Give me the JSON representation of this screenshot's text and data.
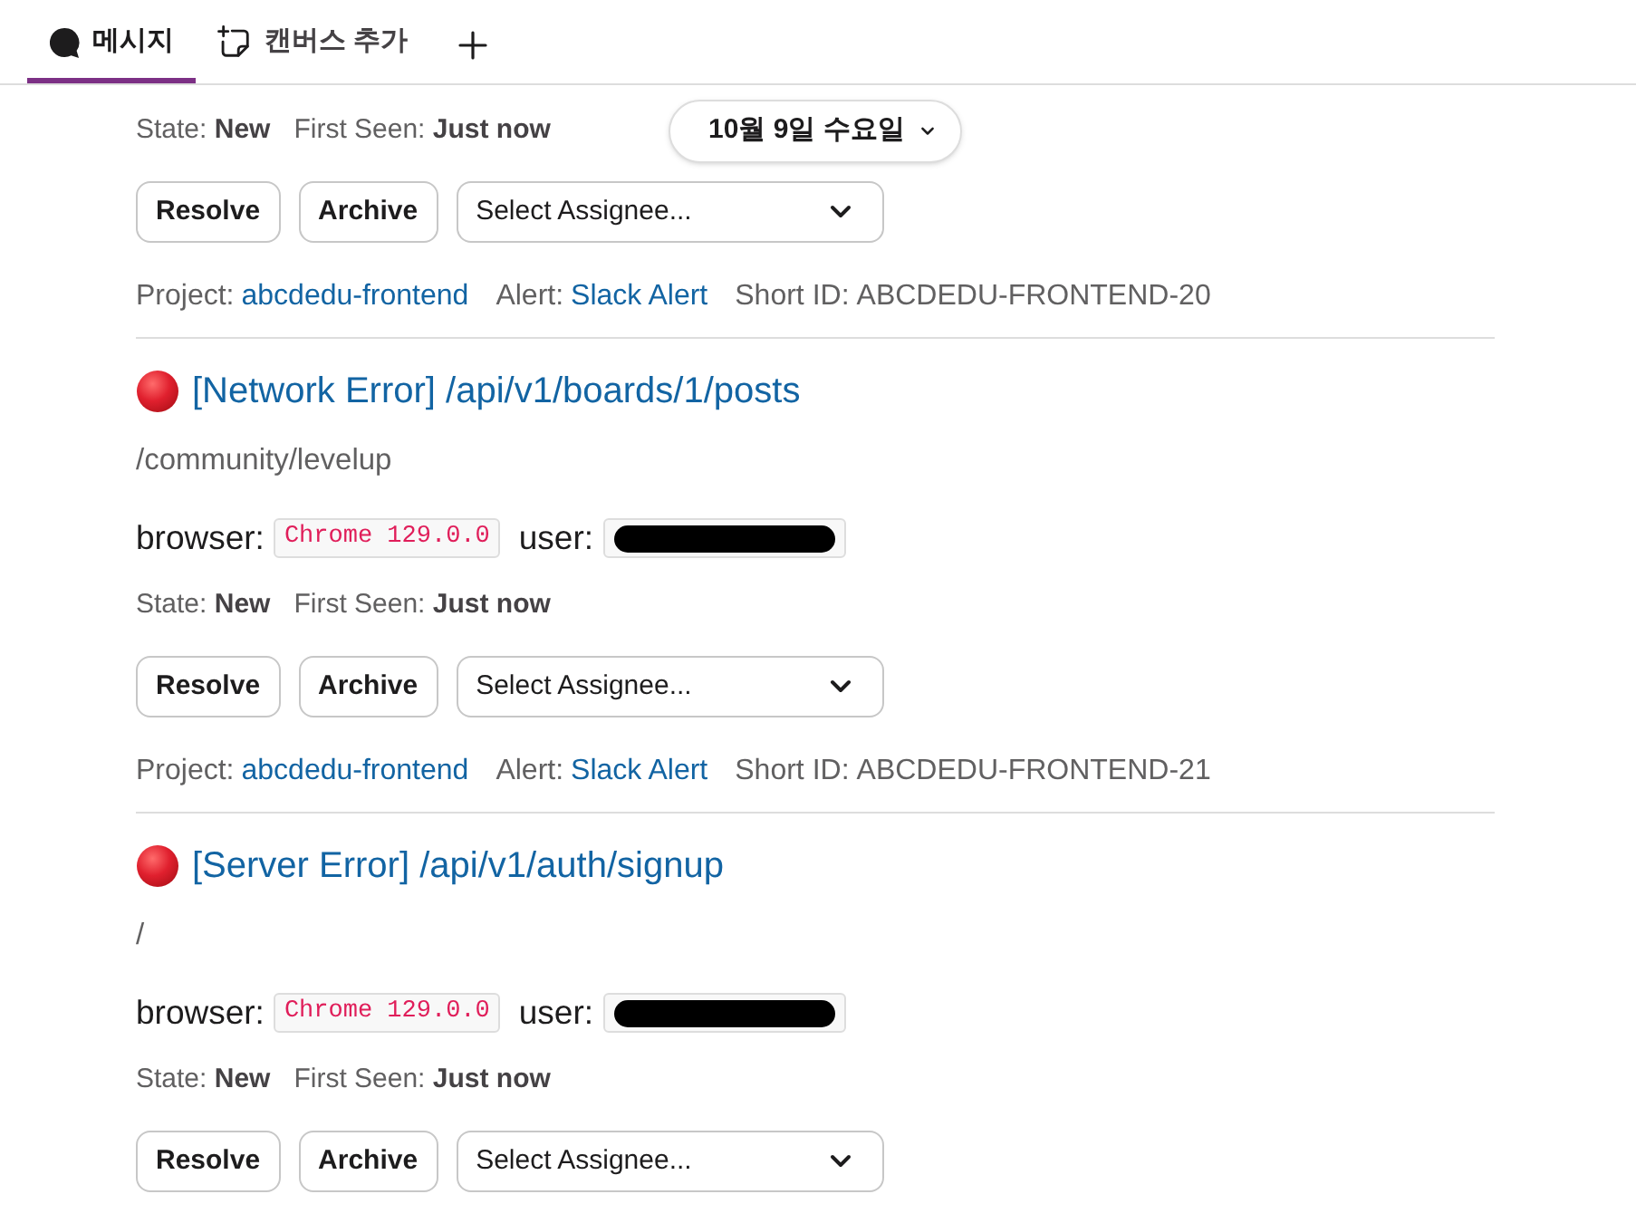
{
  "tabs": [
    {
      "label": "메시지",
      "selected": true
    },
    {
      "label": "캔버스 추가",
      "selected": false
    }
  ],
  "date_divider": {
    "label": "10월 9일 수요일"
  },
  "alerts": [
    {
      "status": [
        "State: **New**",
        "First Seen: **Just now**"
      ],
      "actions": [
        "Resolve",
        "Archive"
      ],
      "assignee": {
        "placeholder": "Select Assignee..."
      },
      "meta": [
        {
          "label": "Project:",
          "value": "abcdedu-frontend",
          "kind": "link"
        },
        {
          "label": "Alert:",
          "value": "Slack Alert",
          "kind": "link"
        },
        {
          "label": "Short ID:",
          "value": "ABCDEDU-FRONTEND-20",
          "kind": "text"
        }
      ]
    },
    {
      "title": "[Network Error] /api/v1/boards/1/posts",
      "path": "/community/levelup",
      "fields": [
        {
          "label": "browser:",
          "value": "Chrome 129.0.0",
          "redacted": false
        },
        {
          "label": "user:",
          "redacted": true
        }
      ],
      "status": [
        "State: **New**",
        "First Seen: **Just now**"
      ],
      "actions": [
        "Resolve",
        "Archive"
      ],
      "assignee": {
        "placeholder": "Select Assignee..."
      },
      "meta": [
        {
          "label": "Project:",
          "value": "abcdedu-frontend",
          "kind": "link"
        },
        {
          "label": "Alert:",
          "value": "Slack Alert",
          "kind": "link"
        },
        {
          "label": "Short ID:",
          "value": "ABCDEDU-FRONTEND-21",
          "kind": "text"
        }
      ]
    },
    {
      "title": "[Server Error] /api/v1/auth/signup",
      "path": "/",
      "fields": [
        {
          "label": "browser:",
          "value": "Chrome 129.0.0",
          "redacted": false
        },
        {
          "label": "user:",
          "redacted": true
        }
      ],
      "status": [
        "State: **New**",
        "First Seen: **Just now**"
      ],
      "actions": [
        "Resolve",
        "Archive"
      ],
      "assignee": {
        "placeholder": "Select Assignee..."
      }
    }
  ]
}
